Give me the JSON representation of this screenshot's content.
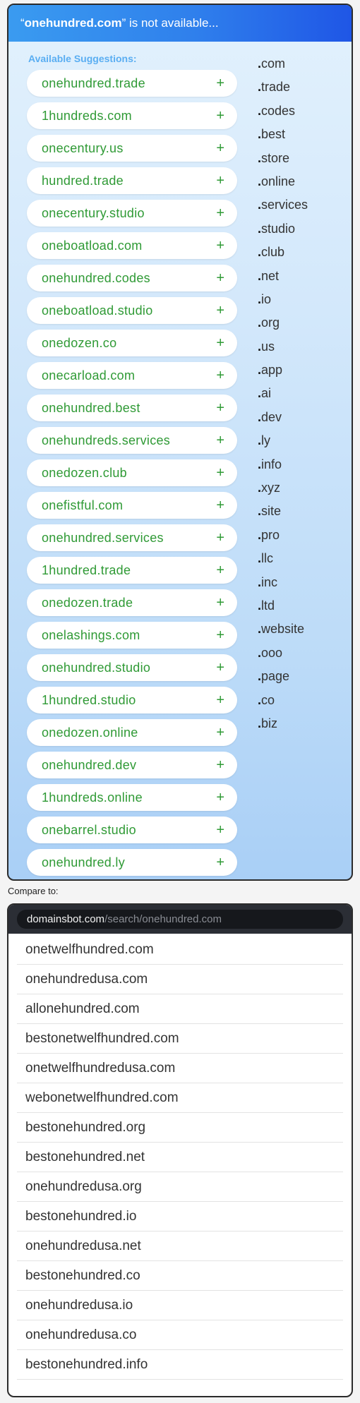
{
  "header": {
    "open_quote": "“",
    "domain": "onehundred.com",
    "message": "” is not available..."
  },
  "suggestions": {
    "title": "Available Suggestions:",
    "add_symbol": "+",
    "items": [
      "onehundred.trade",
      "1hundreds.com",
      "onecentury.us",
      "hundred.trade",
      "onecentury.studio",
      "oneboatload.com",
      "onehundred.codes",
      "oneboatload.studio",
      "onedozen.co",
      "onecarload.com",
      "onehundred.best",
      "onehundreds.services",
      "onedozen.club",
      "onefistful.com",
      "onehundred.services",
      "1hundred.trade",
      "onedozen.trade",
      "onelashings.com",
      "onehundred.studio",
      "1hundred.studio",
      "onedozen.online",
      "onehundred.dev",
      "1hundreds.online",
      "onebarrel.studio",
      "onehundred.ly"
    ]
  },
  "tlds": {
    "dot": ".",
    "items": [
      "com",
      "trade",
      "codes",
      "best",
      "store",
      "online",
      "services",
      "studio",
      "club",
      "net",
      "io",
      "org",
      "us",
      "app",
      "ai",
      "dev",
      "ly",
      "info",
      "xyz",
      "site",
      "pro",
      "llc",
      "inc",
      "ltd",
      "website",
      "ooo",
      "page",
      "co",
      "biz"
    ]
  },
  "compare": {
    "label": "Compare to:",
    "url_host": "domainsbot.com",
    "url_path": "/search/onehundred.com",
    "results": [
      "onetwelfhundred.com",
      "onehundredusa.com",
      "allonehundred.com",
      "bestonetwelfhundred.com",
      "onetwelfhundredusa.com",
      "webonetwelfhundred.com",
      "bestonehundred.org",
      "bestonehundred.net",
      "onehundredusa.org",
      "bestonehundred.io",
      "onehundredusa.net",
      "bestonehundred.co",
      "onehundredusa.io",
      "onehundredusa.co",
      "bestonehundred.info"
    ]
  },
  "colors": {
    "accent_green": "#2f9a35",
    "header_blue": "#2f7fec",
    "title_blue": "#5aaef2"
  }
}
